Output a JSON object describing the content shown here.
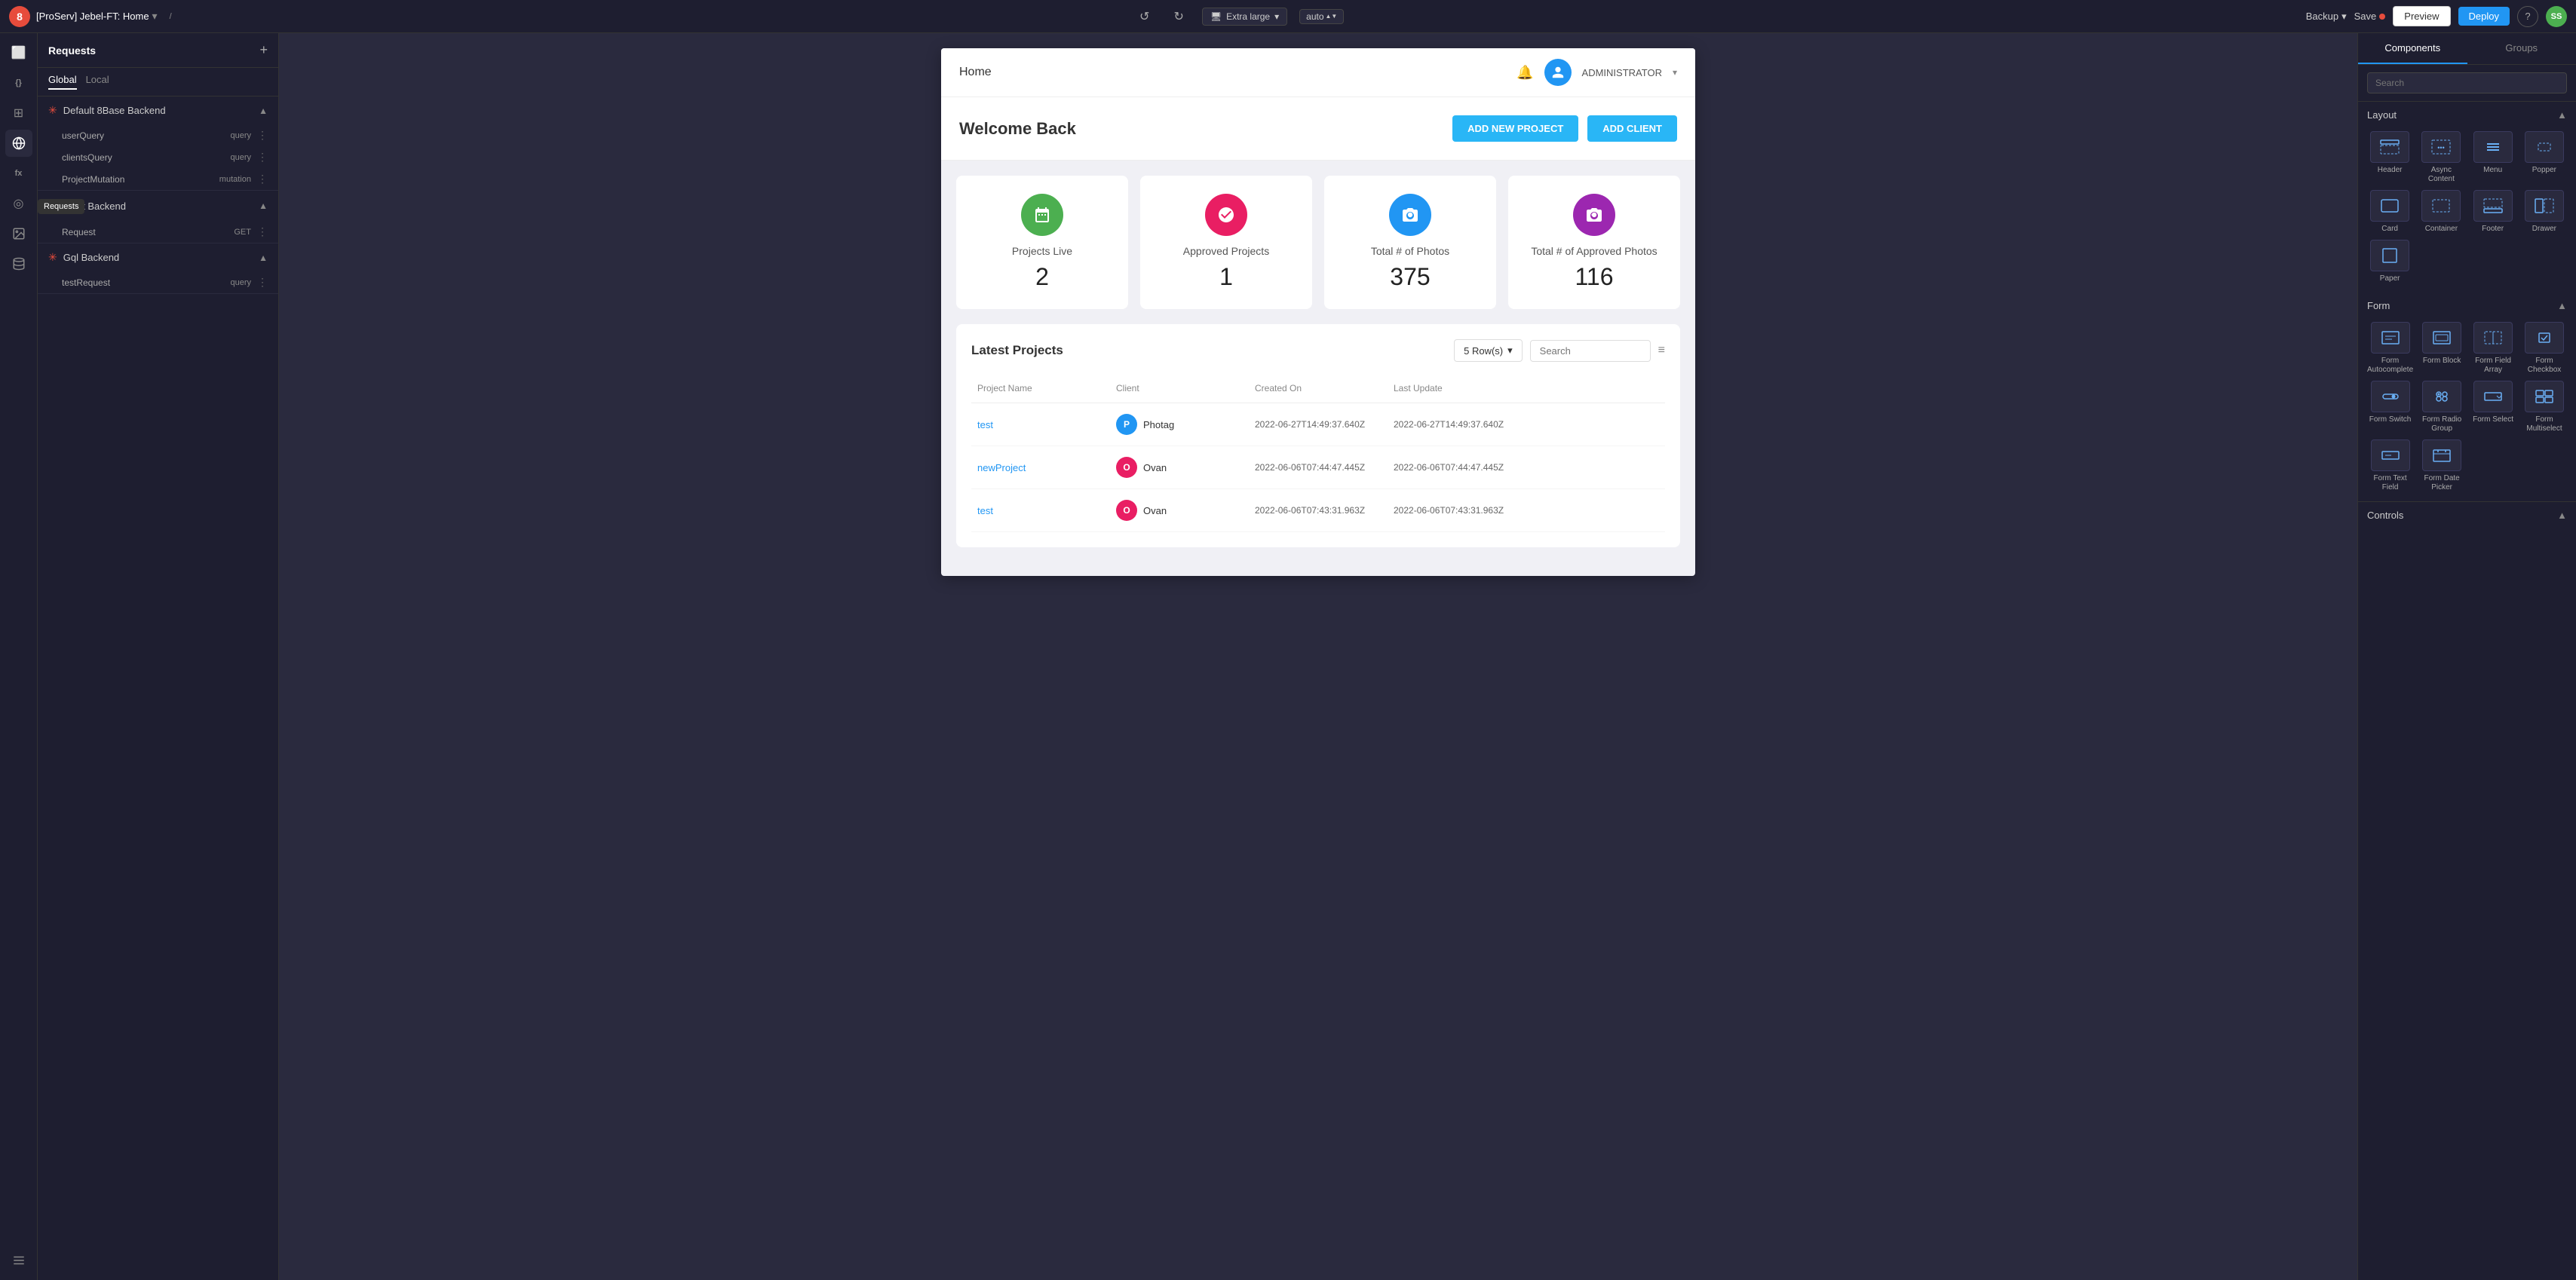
{
  "topbar": {
    "app_number": "8",
    "project_title": "[ProServ] Jebel-FT: Home",
    "breadcrumb": "/",
    "undo_icon": "↺",
    "redo_icon": "↻",
    "device_label": "Extra large",
    "auto_label": "auto",
    "backup_label": "Backup",
    "save_label": "Save",
    "preview_label": "Preview",
    "deploy_label": "Deploy",
    "help_label": "?",
    "user_initials": "SS"
  },
  "icon_sidebar": {
    "items": [
      {
        "name": "page-icon",
        "icon": "⬜",
        "active": false
      },
      {
        "name": "code-icon",
        "icon": "{ }",
        "active": false
      },
      {
        "name": "component-icon",
        "icon": "⊞",
        "active": false
      },
      {
        "name": "requests-icon",
        "icon": "☁",
        "active": false
      },
      {
        "name": "function-icon",
        "icon": "fx",
        "active": false
      },
      {
        "name": "connections-icon",
        "icon": "◎",
        "active": false
      },
      {
        "name": "media-icon",
        "icon": "⊡",
        "active": false
      },
      {
        "name": "database-icon",
        "icon": "⊙",
        "active": false
      },
      {
        "name": "settings-icon",
        "icon": "≡",
        "active": false
      }
    ]
  },
  "requests_panel": {
    "title": "Requests",
    "tabs": [
      "Global",
      "Local"
    ],
    "active_tab": "Global",
    "backends": [
      {
        "name": "Default 8Base Backend",
        "type": "8base",
        "items": [
          {
            "name": "userQuery",
            "badge": "query"
          },
          {
            "name": "clientsQuery",
            "badge": "query"
          },
          {
            "name": "ProjectMutation",
            "badge": "mutation"
          }
        ]
      },
      {
        "name": "Rest Backend",
        "type": "rest",
        "items": [
          {
            "name": "Request",
            "badge": "GET"
          }
        ]
      },
      {
        "name": "Gql Backend",
        "type": "8base",
        "items": [
          {
            "name": "testRequest",
            "badge": "query"
          }
        ]
      }
    ],
    "tooltip": "Requests"
  },
  "canvas": {
    "page_header": {
      "title": "Home",
      "admin_label": "ADMINISTRATOR",
      "admin_icon": "👤"
    },
    "welcome": {
      "text": "Welcome Back",
      "btn_add_project": "ADD NEW PROJECT",
      "btn_add_client": "ADD CLIENT"
    },
    "stats": [
      {
        "label": "Projects Live",
        "value": "2",
        "icon_char": "📋",
        "color": "green"
      },
      {
        "label": "Approved Projects",
        "value": "1",
        "icon_char": "✓",
        "color": "red"
      },
      {
        "label": "Total # of Photos",
        "value": "375",
        "icon_char": "📷",
        "color": "blue"
      },
      {
        "label": "Total # of Approved Photos",
        "value": "116",
        "icon_char": "📷",
        "color": "purple"
      }
    ],
    "latest_projects": {
      "title": "Latest Projects",
      "rows_label": "5 Row(s)",
      "search_placeholder": "Search",
      "columns": [
        "Project Name",
        "Client",
        "Created On",
        "Last Update",
        ""
      ],
      "rows": [
        {
          "name": "test",
          "client_initial": "P",
          "client_name": "Photag",
          "client_color": "#2196f3",
          "created": "2022-06-27T14:49:37.640Z",
          "updated": "2022-06-27T14:49:37.640Z"
        },
        {
          "name": "newProject",
          "client_initial": "O",
          "client_name": "Ovan",
          "client_color": "#e91e63",
          "created": "2022-06-06T07:44:47.445Z",
          "updated": "2022-06-06T07:44:47.445Z"
        },
        {
          "name": "test",
          "client_initial": "O",
          "client_name": "Ovan",
          "client_color": "#e91e63",
          "created": "2022-06-06T07:43:31.963Z",
          "updated": "2022-06-06T07:43:31.963Z"
        }
      ]
    }
  },
  "right_panel": {
    "tabs": [
      "Components",
      "Groups"
    ],
    "active_tab": "Components",
    "search_placeholder": "Search",
    "sections": {
      "layout": {
        "title": "Layout",
        "items": [
          {
            "label": "Header",
            "icon": "▭"
          },
          {
            "label": "Async Content",
            "icon": "⋯"
          },
          {
            "label": "Menu",
            "icon": "☰"
          },
          {
            "label": "Popper",
            "icon": "◇"
          },
          {
            "label": "Card",
            "icon": "▭"
          },
          {
            "label": "Container",
            "icon": "▭"
          },
          {
            "label": "Footer",
            "icon": "▭"
          },
          {
            "label": "Drawer",
            "icon": "▦"
          },
          {
            "label": "Paper",
            "icon": "▭"
          }
        ]
      },
      "form": {
        "title": "Form",
        "items": [
          {
            "label": "Form Autocomplete",
            "icon": "≡"
          },
          {
            "label": "Form Block",
            "icon": "▭"
          },
          {
            "label": "Form Field Array",
            "icon": "▦"
          },
          {
            "label": "Form Checkbox",
            "icon": "☑"
          },
          {
            "label": "Form Switch",
            "icon": "⊡"
          },
          {
            "label": "Form Radio Group",
            "icon": "⊙"
          },
          {
            "label": "Form Select",
            "icon": "▭"
          },
          {
            "label": "Form Multiselect",
            "icon": "▦"
          },
          {
            "label": "Form Text Field",
            "icon": "▭"
          },
          {
            "label": "Form Date Picker",
            "icon": "▦"
          }
        ]
      },
      "controls": {
        "title": "Controls"
      }
    }
  }
}
